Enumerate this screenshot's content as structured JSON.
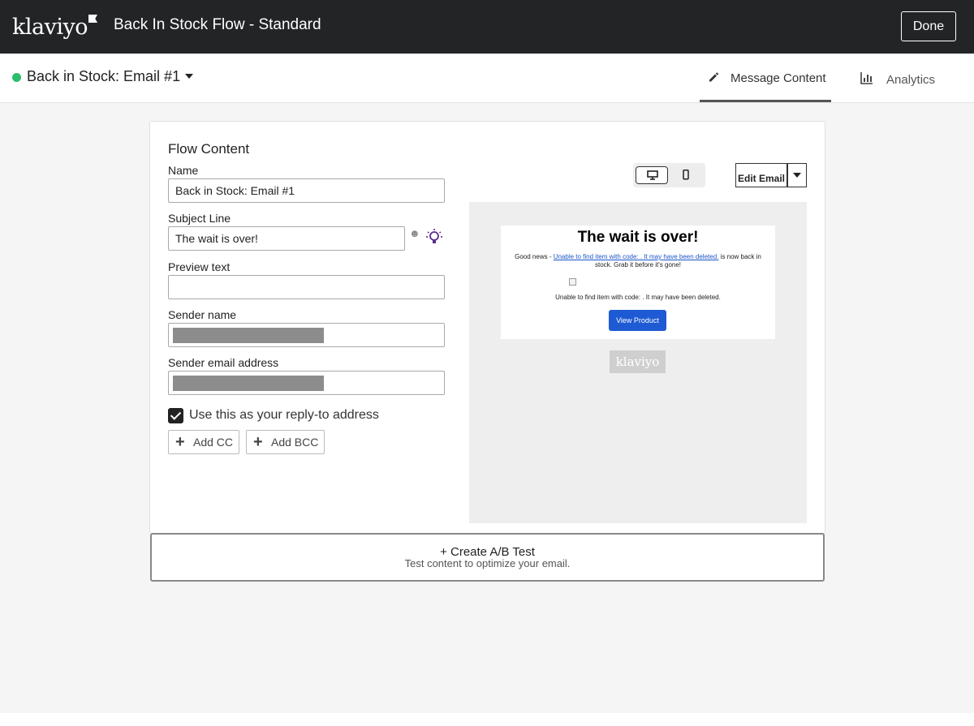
{
  "header": {
    "logo_text": "klaviyo",
    "flow_title": "Back In Stock Flow - Standard",
    "done_label": "Done"
  },
  "subheader": {
    "email_name": "Back in Stock: Email #1",
    "status_color": "#2bbd6e",
    "tabs": [
      {
        "label": "Message Content",
        "icon": "pencil-icon",
        "active": true
      },
      {
        "label": "Analytics",
        "icon": "bar-chart-icon",
        "active": false
      }
    ]
  },
  "flow_content": {
    "title": "Flow Content",
    "fields": {
      "name": {
        "label": "Name",
        "value": "Back in Stock: Email #1"
      },
      "subject": {
        "label": "Subject Line",
        "value": "The wait is over!"
      },
      "preview": {
        "label": "Preview text",
        "value": ""
      },
      "sender_name": {
        "label": "Sender name",
        "value": ""
      },
      "sender_email": {
        "label": "Sender email address",
        "value": ""
      }
    },
    "reply_to_label": "Use this as your reply-to address",
    "reply_to_checked": true,
    "add_cc_label": "Add CC",
    "add_bcc_label": "Add BCC"
  },
  "preview": {
    "edit_email_label": "Edit Email",
    "headline": "The wait is over!",
    "body_prefix": "Good news - ",
    "body_link": "Unable to find item with code: . It may have been deleted.",
    "body_suffix": " is now back in stock. Grab it before it's gone!",
    "alt_text": "Unable to find item with code: . It may have been deleted.",
    "cta_label": "View Product",
    "cta_color": "#1d5ad3",
    "footer_logo": "klaviyo"
  },
  "ab_test": {
    "title": "+ Create A/B Test",
    "subtitle": "Test content to optimize your email."
  }
}
